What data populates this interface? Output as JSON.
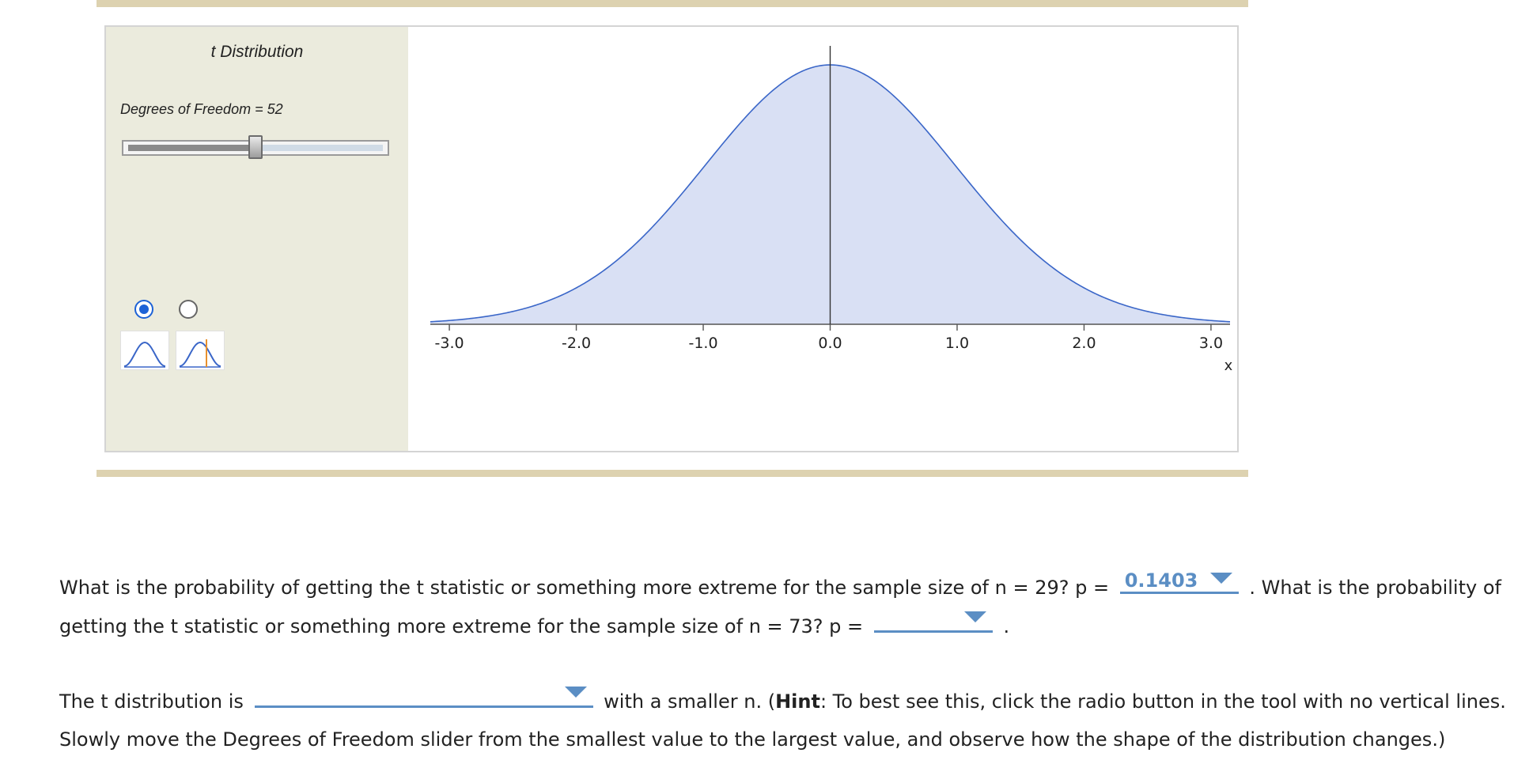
{
  "tool": {
    "title": "t Distribution",
    "df_label": "Degrees of Freedom = 52",
    "slider_level": 0.5,
    "radio_selected_index": 0,
    "colors": {
      "curve": "#3a66c8",
      "fill": "#d9e0f4",
      "panel": "#ebebdd",
      "marker": "#e8912e"
    }
  },
  "chart_data": {
    "type": "area",
    "distribution": "t",
    "degrees_of_freedom": 52,
    "xlim": [
      -3.15,
      3.15
    ],
    "x_ticks": [
      "-3.0",
      "-2.0",
      "-1.0",
      "0.0",
      "1.0",
      "2.0",
      "3.0"
    ],
    "x_tick_values": [
      -3,
      -2,
      -1,
      0,
      1,
      2,
      3
    ],
    "xlabel": "x",
    "center_line_x": 0.0
  },
  "question1": {
    "part1": "What is the probability of getting the t statistic or something more extreme for the sample size of n = 29? p =",
    "answer1": "0.1403",
    "part2": ". What is the probability of getting the t statistic or something more extreme for the sample size of n = 73? p =",
    "answer2": "",
    "part3": "."
  },
  "question2": {
    "part1": "The t distribution is",
    "answer": "",
    "part2": "with a smaller n. (",
    "hint_label": "Hint",
    "part3": ": To best see this, click the radio button in the tool with no vertical lines. Slowly move the Degrees of Freedom slider from the smallest value to the largest value, and observe how the shape of the distribution changes.)"
  }
}
